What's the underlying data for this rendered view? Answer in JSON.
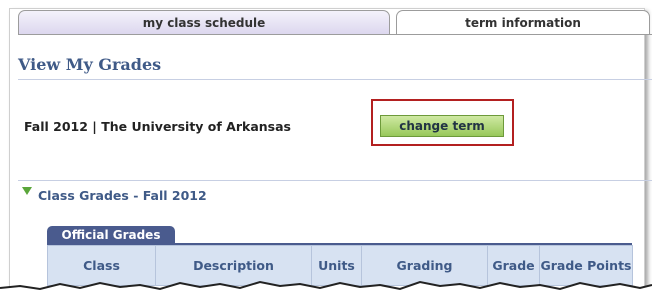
{
  "tabs": {
    "schedule_label": "my class schedule",
    "term_label": "term information"
  },
  "page_title": "View My Grades",
  "term": {
    "text": "Fall 2012 | The University of Arkansas",
    "change_button": "change term"
  },
  "section": {
    "title": "Class Grades - Fall 2012"
  },
  "grades_table": {
    "tab_label": "Official Grades",
    "columns": [
      "Class",
      "Description",
      "Units",
      "Grading",
      "Grade",
      "Grade Points"
    ]
  },
  "colors": {
    "title_blue": "#3f5a87",
    "tab_navy": "#4a5b8e",
    "button_green": "#98c85a",
    "highlight_red": "#b32020"
  }
}
